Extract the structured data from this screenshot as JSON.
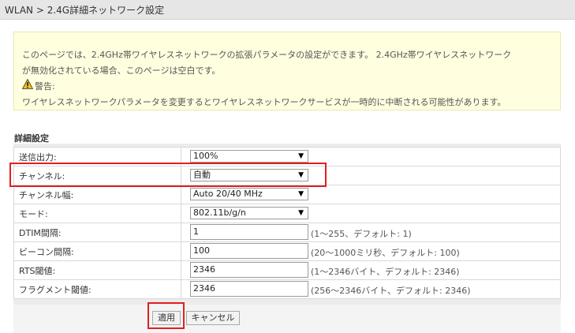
{
  "header": {
    "breadcrumb": "WLAN > 2.4G詳細ネットワーク設定"
  },
  "note": {
    "line1": "このページでは、2.4GHz帯ワイヤレスネットワークの拡張パラメータの設定ができます。 2.4GHz帯ワイヤレスネットワーク",
    "line2": "が無効化されている場合、このページは空白です。",
    "warning_label": "警告:",
    "warning_text": "ワイヤレスネットワークパラメータを変更するとワイヤレスネットワークサービスが一時的に中断される可能性があります。"
  },
  "section": {
    "title": "詳細設定"
  },
  "rows": {
    "tx_power": {
      "label": "送信出力:",
      "value": "100%"
    },
    "channel": {
      "label": "チャンネル:",
      "value": "自動"
    },
    "channel_width": {
      "label": "チャンネル幅:",
      "value": "Auto 20/40 MHz"
    },
    "mode": {
      "label": "モード:",
      "value": "802.11b/g/n"
    },
    "dtim": {
      "label": "DTIM間隔:",
      "value": "1",
      "hint": "(1〜255、デフォルト: 1)"
    },
    "beacon": {
      "label": "ビーコン間隔:",
      "value": "100",
      "hint": "(20〜1000ミリ秒、デフォルト: 100)"
    },
    "rts": {
      "label": "RTS閾値:",
      "value": "2346",
      "hint": "(1〜2346バイト、デフォルト: 2346)"
    },
    "frag": {
      "label": "フラグメント閾値:",
      "value": "2346",
      "hint": "(256〜2346バイト、デフォルト: 2346)"
    }
  },
  "buttons": {
    "apply": "適用",
    "cancel": "キャンセル"
  },
  "colors": {
    "highlight": "#e02020",
    "note_bg": "#ffffe0",
    "warning": "#f0c020"
  }
}
